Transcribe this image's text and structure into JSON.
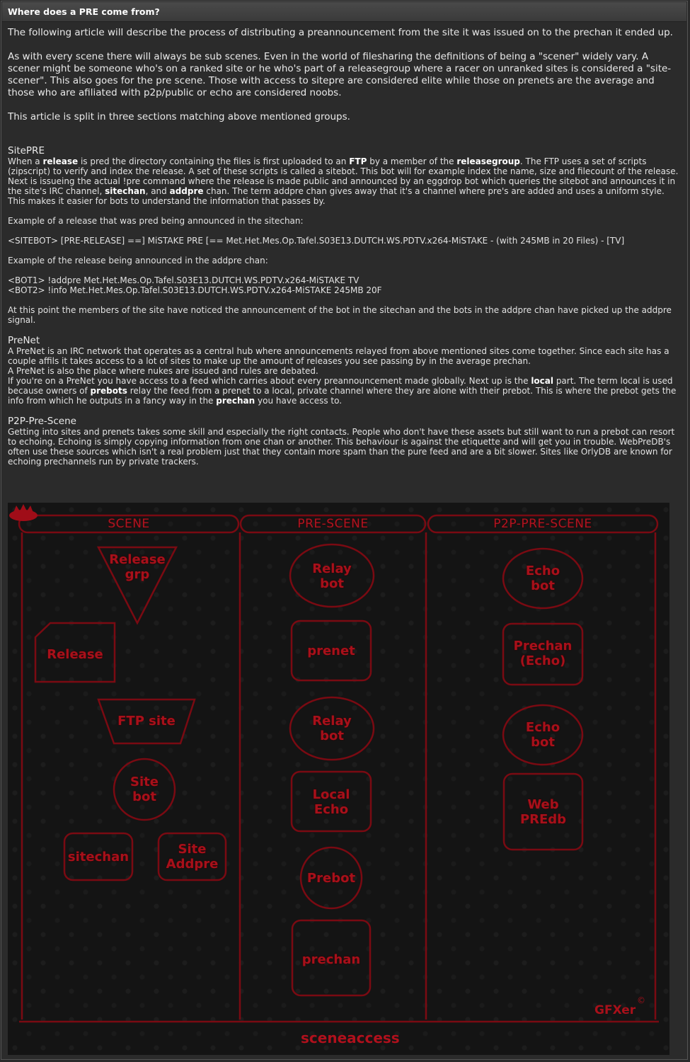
{
  "title": "Where does a PRE come from?",
  "intro": [
    "The following article will describe the process of distributing a preannouncement from the site it was issued on to the prechan it ended up.",
    "As with every scene there will always be sub scenes. Even in the world of filesharing the definitions of being a \"scener\" widely vary. A scener might be someone who's on a ranked site or he who's part of a releasegroup where a racer on unranked sites is considered a \"site-scener\". This also goes for the pre scene. Those with access to sitepre are considered elite while those on prenets are the average and those who are afiliated with p2p/public or echo are considered noobs.",
    "This article is split in three sections matching above mentioned groups."
  ],
  "sitepre": {
    "heading": "SitePRE",
    "p1_a": "When a ",
    "p1_b": "release",
    "p1_c": " is pred the directory containing the files is first uploaded to an ",
    "p1_d": "FTP",
    "p1_e": " by a member of the ",
    "p1_f": "releasegroup",
    "p1_g": ". The FTP uses a set of scripts (zipscript) to verify and index the release. A set of these scripts is called a sitebot. This bot will for example index the name, size and filecount of the release.",
    "p2_a": "Next is issueing the actual !pre command where the release is made public and announced by an eggdrop bot which queries the sitebot and announces it in the site's IRC channel, ",
    "p2_b": "sitechan",
    "p2_c": ",  and ",
    "p2_d": "addpre",
    "p2_e": " chan. The term addpre chan gives away that it's a channel where pre's are added and uses a uniform style. This makes it easier for bots to understand the information that passes by.",
    "example1_label": "Example of a release that was pred being announced in the sitechan:",
    "example1": "<SITEBOT>  [PRE-RELEASE] ==] MiSTAKE PRE [== Met.Het.Mes.Op.Tafel.S03E13.DUTCH.WS.PDTV.x264-MiSTAKE - (with 245MB in 20 Files) - [TV]",
    "example2_label": "Example of the release being announced in the addpre chan:",
    "example2_line1": "<BOT1> !addpre Met.Het.Mes.Op.Tafel.S03E13.DUTCH.WS.PDTV.x264-MiSTAKE TV",
    "example2_line2": "<BOT2> !info Met.Het.Mes.Op.Tafel.S03E13.DUTCH.WS.PDTV.x264-MiSTAKE 245MB 20F",
    "closing": "At this point the members of the site have noticed the announcement of the bot in the sitechan and the bots in the addpre chan have picked up the addpre signal."
  },
  "prenet": {
    "heading": "PreNet",
    "l1": "A PreNet is an IRC network that operates as a central hub where announcements relayed from above mentioned sites come together. Since each site has a couple affils it takes access to a lot of sites to make up the amount of releases you see passing by in the average prechan.",
    "l2": "A PreNet is also the place where nukes are issued and rules are debated.",
    "l3_a": "If you're on a PreNet you have access to a feed which carries about every preannouncement made globally. Next up is the ",
    "l3_b": "local",
    "l3_c": " part. The term local is used because owners of ",
    "l3_d": "prebots",
    "l3_e": " relay the feed from a prenet to a local, private channel where they are alone with their prebot. This is where the prebot gets the info from which he outputs in a fancy way in the ",
    "l3_f": "prechan",
    "l3_g": " you have access to."
  },
  "p2p": {
    "heading": "P2P-Pre-Scene",
    "text": "Getting into sites and prenets takes some skill and especially the right contacts. People who don't have these assets but still want to run a prebot can resort to echoing. Echoing is simply copying information from one chan or another. This behaviour is against the etiquette and will get you in trouble. WebPreDB's often use these sources which isn't a real problem just that they contain more spam than the pure feed and are a bit slower. Sites like OrlyDB are known for echoing prechannels run by private trackers."
  },
  "diagram": {
    "col1": "SCENE",
    "col2": "PRE-SCENE",
    "col3": "P2P-PRE-SCENE",
    "release_grp_1": "Release",
    "release_grp_2": "grp",
    "release": "Release",
    "ftp_site": "FTP site",
    "site_bot_1": "Site",
    "site_bot_2": "bot",
    "sitechan": "sitechan",
    "site_addpre_1": "Site",
    "site_addpre_2": "Addpre",
    "relay_bot_1": "Relay",
    "relay_bot_2": "bot",
    "prenet": "prenet",
    "relay_bot2_1": "Relay",
    "relay_bot2_2": "bot",
    "local_echo_1": "Local",
    "local_echo_2": "Echo",
    "prebot": "Prebot",
    "prechan": "prechan",
    "echo_bot_1": "Echo",
    "echo_bot_2": "bot",
    "prechan_echo_1": "Prechan",
    "prechan_echo_2": "(Echo)",
    "echo_bot2_1": "Echo",
    "echo_bot2_2": "bot",
    "webpredb_1": "Web",
    "webpredb_2": "PREdb",
    "signature": "GFXer",
    "copyright": "©",
    "brand": "sceneaccess",
    "accent": "#a8101a"
  }
}
